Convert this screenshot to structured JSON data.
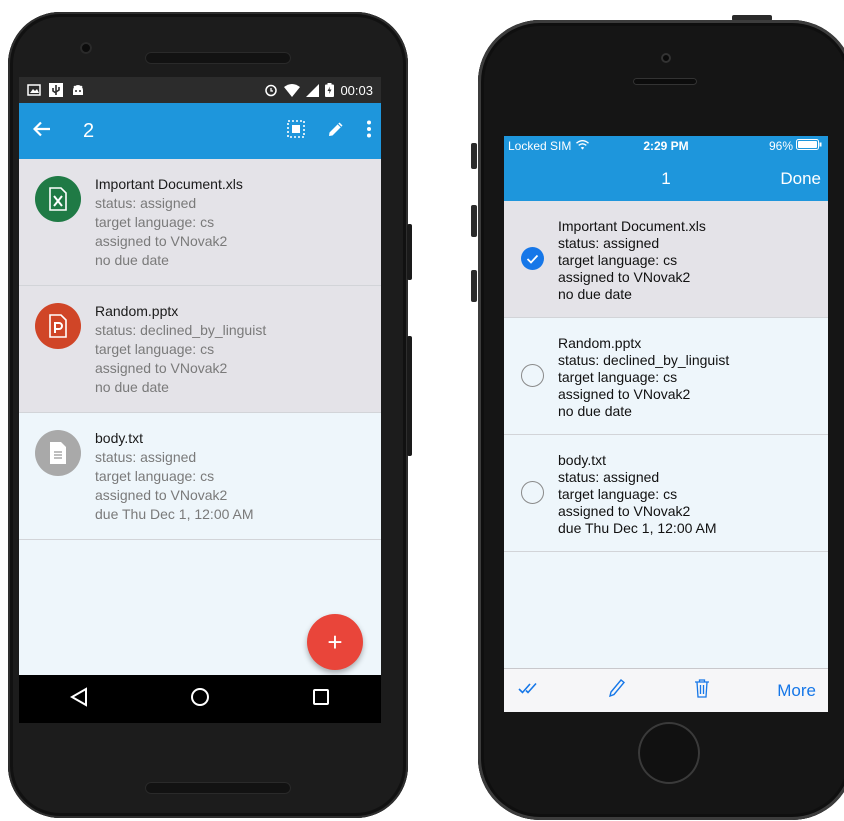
{
  "android": {
    "status_time": "00:03",
    "toolbar": {
      "title": "2"
    },
    "items": [
      {
        "icon": "excel-file-icon",
        "color": "#1f7a45",
        "selected": true,
        "filename": "Important Document.xls",
        "status": "status: assigned",
        "language": "target language: cs",
        "assignee": "assigned to VNovak2",
        "due": "no due date"
      },
      {
        "icon": "powerpoint-file-icon",
        "color": "#d04527",
        "selected": true,
        "filename": "Random.pptx",
        "status": "status: declined_by_linguist",
        "language": "target language: cs",
        "assignee": "assigned to VNovak2",
        "due": "no due date"
      },
      {
        "icon": "text-file-icon",
        "color": "#a9a9a9",
        "selected": false,
        "filename": "body.txt",
        "status": "status: assigned",
        "language": "target language: cs",
        "assignee": "assigned to VNovak2",
        "due": "due Thu Dec 1, 12:00 AM"
      }
    ],
    "fab_label": "+"
  },
  "ios": {
    "status": {
      "carrier": "Locked SIM",
      "time": "2:29 PM",
      "battery": "96%"
    },
    "nav": {
      "title": "1",
      "done_label": "Done"
    },
    "items": [
      {
        "checked": true,
        "filename": "Important Document.xls",
        "status": "status: assigned",
        "language": "target language: cs",
        "assignee": "assigned to VNovak2",
        "due": "no due date"
      },
      {
        "checked": false,
        "filename": "Random.pptx",
        "status": "status: declined_by_linguist",
        "language": "target language: cs",
        "assignee": "assigned to VNovak2",
        "due": "no due date"
      },
      {
        "checked": false,
        "filename": "body.txt",
        "status": "status: assigned",
        "language": "target language: cs",
        "assignee": "assigned to VNovak2",
        "due": "due Thu Dec 1, 12:00 AM"
      }
    ],
    "toolbar": {
      "more_label": "More"
    }
  },
  "colors": {
    "accent": "#1e96dc",
    "ios_tint": "#1677e8",
    "fab": "#e9453a",
    "selected_row": "#e4e3e8",
    "list_bg": "#eef6fb"
  }
}
